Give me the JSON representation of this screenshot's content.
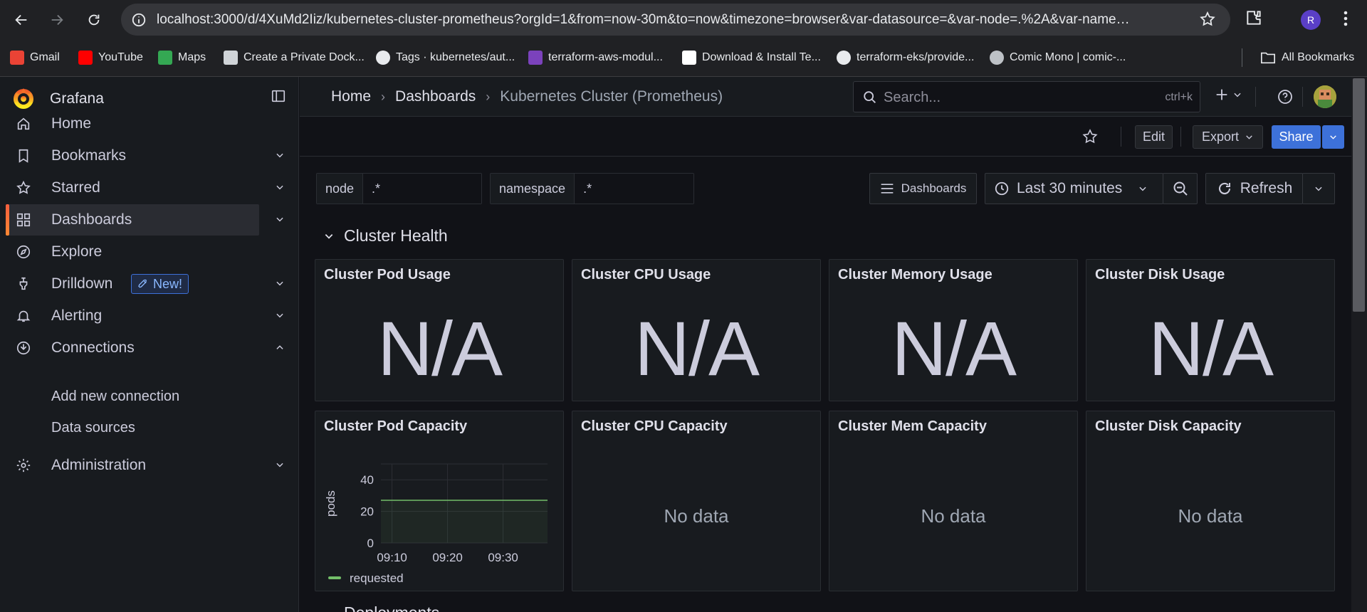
{
  "browser": {
    "url": "localhost:3000/d/4XuMd2Iiz/kubernetes-cluster-prometheus?orgId=1&from=now-30m&to=now&timezone=browser&var-datasource=&var-node=.%2A&var-name…",
    "profile_initial": "R",
    "bookmarks": [
      {
        "label": "Gmail",
        "icon": "gmail-icon",
        "color": "#ea4335"
      },
      {
        "label": "YouTube",
        "icon": "youtube-icon",
        "color": "#ff0000"
      },
      {
        "label": "Maps",
        "icon": "maps-icon",
        "color": "#34a853"
      },
      {
        "label": "Create a Private Dock...",
        "icon": "wordpress-icon",
        "color": "#d0d4d8"
      },
      {
        "label": "Tags · kubernetes/aut...",
        "icon": "github-icon",
        "color": "#e8eaed"
      },
      {
        "label": "terraform-aws-modul...",
        "icon": "terraform-icon",
        "color": "#7b42bc"
      },
      {
        "label": "Download & Install Te...",
        "icon": "download-site-icon",
        "color": "#ffffff"
      },
      {
        "label": "terraform-eks/provide...",
        "icon": "github-icon",
        "color": "#e8eaed"
      },
      {
        "label": "Comic Mono | comic-...",
        "icon": "globe-icon",
        "color": "#bdc1c6"
      }
    ],
    "all_bookmarks": "All Bookmarks"
  },
  "grafana": {
    "brand": "Grafana",
    "nav": [
      {
        "label": "Home",
        "icon": "home-icon",
        "chevron": ""
      },
      {
        "label": "Bookmarks",
        "icon": "bookmark-icon",
        "chevron": "down"
      },
      {
        "label": "Starred",
        "icon": "star-icon",
        "chevron": "down"
      },
      {
        "label": "Dashboards",
        "icon": "apps-icon",
        "chevron": "down",
        "active": true
      },
      {
        "label": "Explore",
        "icon": "compass-icon",
        "chevron": ""
      },
      {
        "label": "Drilldown",
        "icon": "drilldown-icon",
        "chevron": "down",
        "badge": "New!"
      },
      {
        "label": "Alerting",
        "icon": "bell-icon",
        "chevron": "down"
      },
      {
        "label": "Connections",
        "icon": "connections-icon",
        "chevron": "up"
      },
      {
        "label": "Administration",
        "icon": "cog-icon",
        "chevron": "down"
      }
    ],
    "connections_sub": [
      "Add new connection",
      "Data sources"
    ],
    "breadcrumb": [
      "Home",
      "Dashboards",
      "Kubernetes Cluster (Prometheus)"
    ],
    "search_placeholder": "Search...",
    "search_shortcut": "ctrl+k",
    "actions": {
      "edit": "Edit",
      "export": "Export",
      "share": "Share"
    },
    "variables": [
      {
        "label": "node",
        "value": ".*"
      },
      {
        "label": "namespace",
        "value": ".*"
      }
    ],
    "controls": {
      "dashboards": "Dashboards",
      "time_range": "Last 30 minutes",
      "refresh": "Refresh"
    },
    "row_title": "Cluster Health",
    "stat_panels": [
      {
        "title": "Cluster Pod Usage",
        "value": "N/A"
      },
      {
        "title": "Cluster CPU Usage",
        "value": "N/A"
      },
      {
        "title": "Cluster Memory Usage",
        "value": "N/A"
      },
      {
        "title": "Cluster Disk Usage",
        "value": "N/A"
      }
    ],
    "capacity_panels": [
      {
        "title": "Cluster Pod Capacity",
        "chart": true
      },
      {
        "title": "Cluster CPU Capacity",
        "message": "No data"
      },
      {
        "title": "Cluster Mem Capacity",
        "message": "No data"
      },
      {
        "title": "Cluster Disk Capacity",
        "message": "No data"
      }
    ],
    "next_row_title": "Deployments"
  },
  "chart_data": {
    "type": "line",
    "title": "Cluster Pod Capacity",
    "ylabel": "pods",
    "xlabel": "",
    "x_ticks": [
      "09:10",
      "09:20",
      "09:30"
    ],
    "y_ticks": [
      0,
      20,
      40
    ],
    "ylim": [
      0,
      50
    ],
    "grid": true,
    "legend": "bottom-left",
    "series": [
      {
        "name": "requested",
        "color": "#73bf69",
        "x": [
          "09:08",
          "09:38"
        ],
        "values": [
          27,
          27
        ]
      }
    ]
  }
}
